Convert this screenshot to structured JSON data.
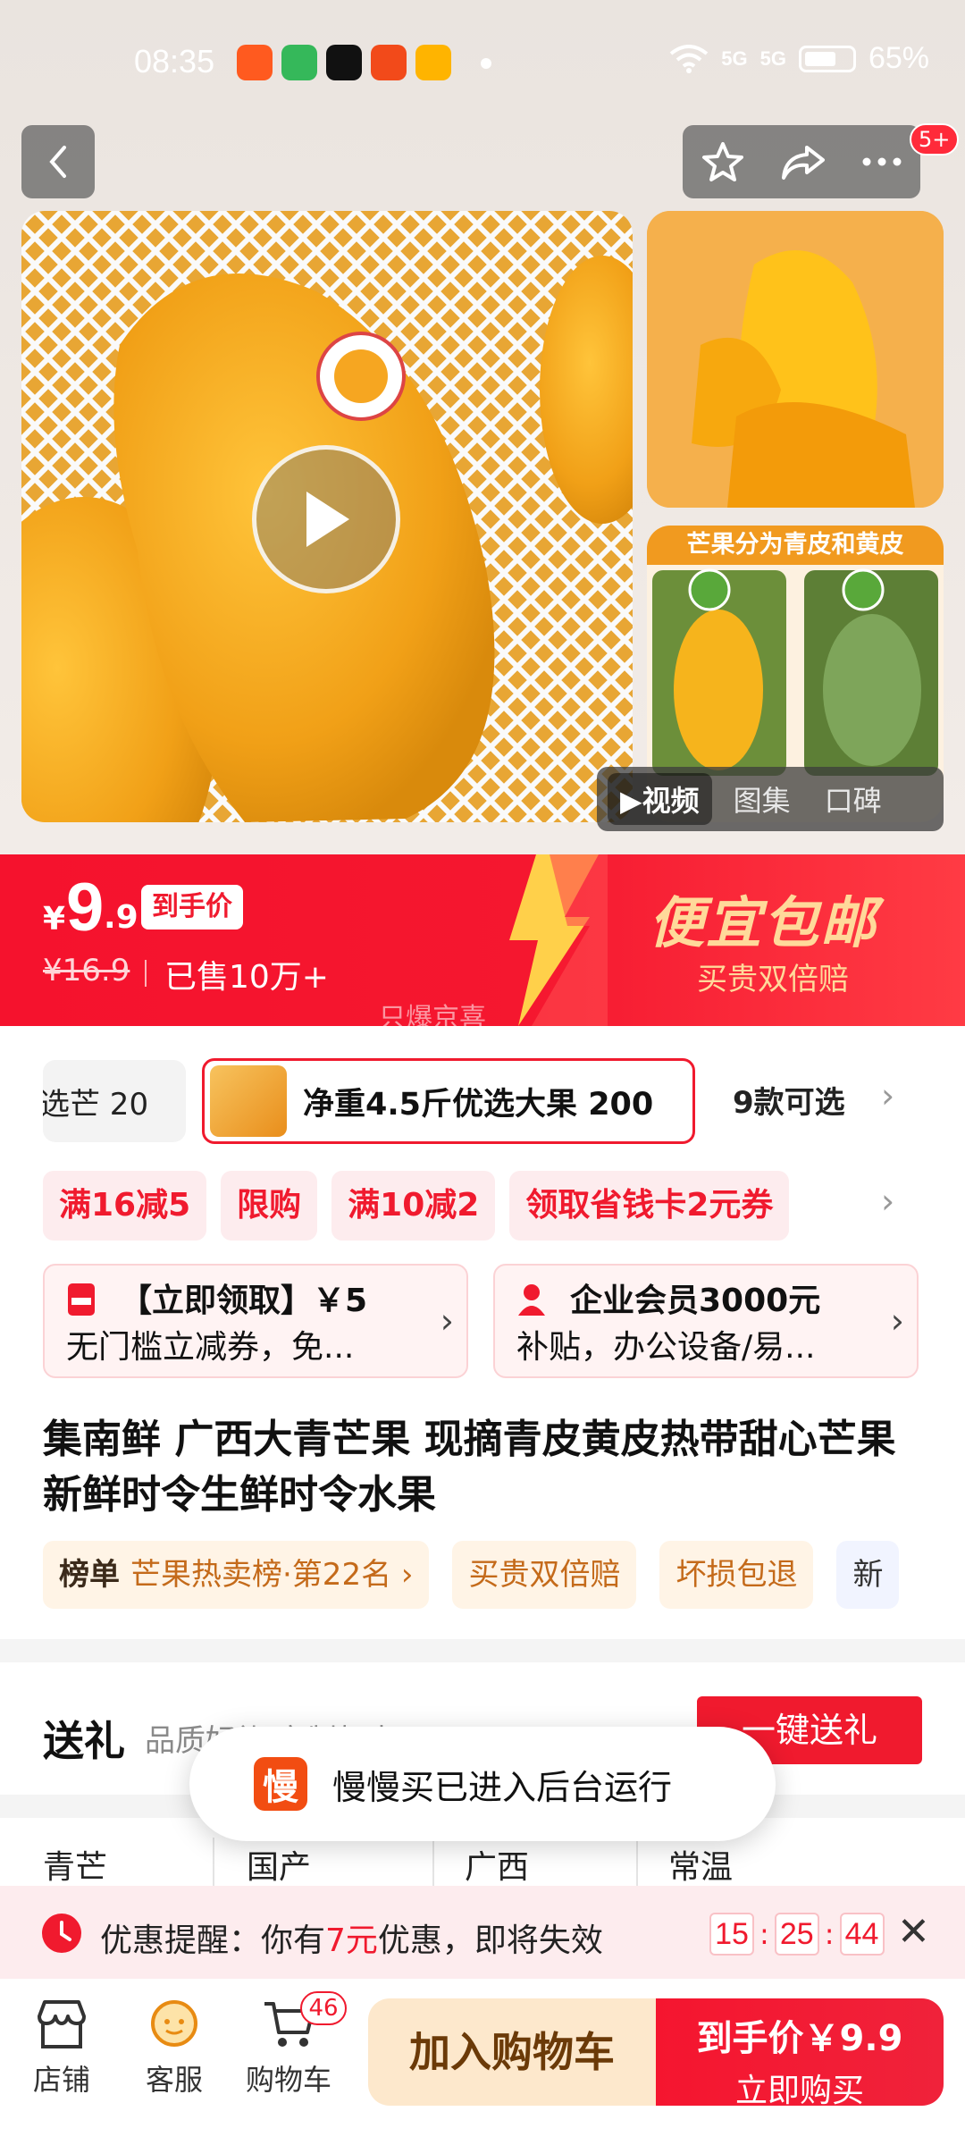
{
  "status_bar": {
    "time": "08:35",
    "signal1": "5G",
    "signal2": "5G",
    "battery": "65%"
  },
  "header": {
    "badge": "5+"
  },
  "media": {
    "side_image_title": "芒果分为青皮和黄皮",
    "tabs": [
      "视频",
      "图集",
      "口碑"
    ]
  },
  "price_banner": {
    "currency": "¥",
    "price_int": "9",
    "price_dec": ".9",
    "price_tag": "到手价",
    "original_price": "¥16.9",
    "sold": "已售10万+",
    "promo_title": "便宜包邮",
    "promo_sub": "买贵双倍赔",
    "ghost_text": "只爆京喜"
  },
  "specs": {
    "chip1": "选芒 20",
    "chip2": "净重4.5斤优选大果  200",
    "more": "9款可选"
  },
  "promos": [
    "满16减5",
    "限购",
    "满10减2",
    "领取省钱卡2元券"
  ],
  "coupons": [
    {
      "line1": "【立即领取】￥5",
      "line2": "无门槛立减券，免..."
    },
    {
      "line1": "企业会员3000元",
      "line2": "补贴，办公设备/易..."
    }
  ],
  "product": {
    "title": "集南鲜 广西大青芒果 现摘青皮黄皮热带甜心芒果新鲜时令生鲜时令水果"
  },
  "tags": {
    "rank_label": "榜单",
    "rank_value": "芒果热卖榜·第22名",
    "tag2": "买贵双倍赔",
    "tag3": "坏损包退",
    "tag4": "新"
  },
  "gift": {
    "title": "送礼",
    "subtitle": "品质好礼 定制贺卡",
    "button": "一键送礼"
  },
  "attributes": [
    "青芒",
    "国产",
    "广西",
    "常温"
  ],
  "toast": {
    "icon_text": "慢",
    "message": "慢慢买已进入后台运行"
  },
  "reminder": {
    "prefix": "优惠提醒：你有",
    "amount": "7元",
    "suffix": "优惠，即将失效",
    "hours": "15",
    "minutes": "25",
    "seconds": "44"
  },
  "bottom_bar": {
    "shop": "店铺",
    "service": "客服",
    "cart": "购物车",
    "cart_count": "46",
    "add_cart": "加入购物车",
    "buy_line1": "到手价￥9.9",
    "buy_line2": "立即购买"
  }
}
